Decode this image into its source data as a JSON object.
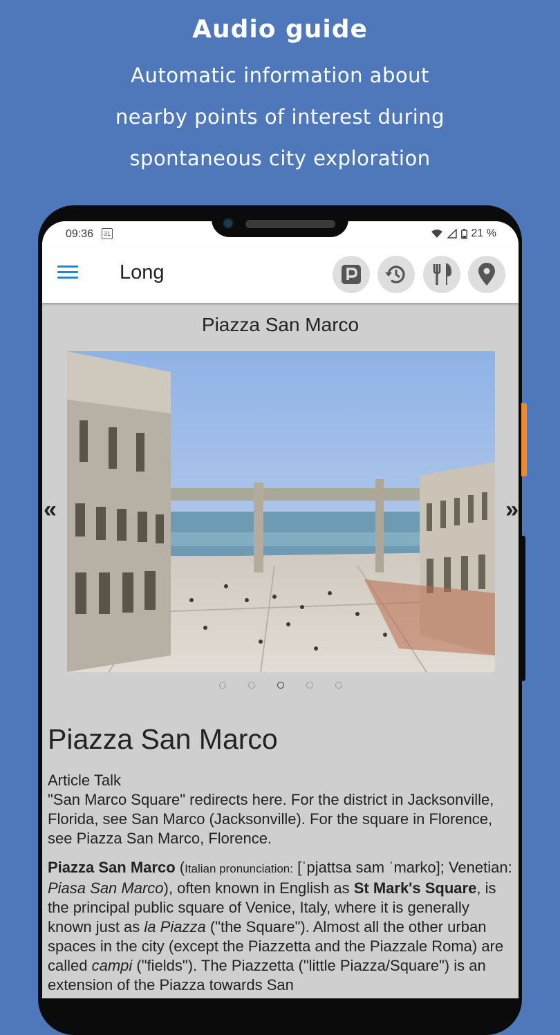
{
  "promo": {
    "title": "Audio guide",
    "line1": "Automatic information about",
    "line2": "nearby points of interest during",
    "line3": "spontaneous city exploration"
  },
  "status_bar": {
    "time": "09:36",
    "calendar_day": "31",
    "battery": "21 %"
  },
  "app_bar": {
    "title": "Long",
    "actions": [
      "parking-icon",
      "history-icon",
      "restaurant-icon",
      "location-pin-icon"
    ]
  },
  "place": {
    "title": "Piazza San Marco",
    "prev_label": "«",
    "next_label": "»",
    "carousel_count": 5,
    "carousel_active_index": 2
  },
  "article": {
    "heading": "Piazza San Marco",
    "tabs_line": "Article Talk",
    "redirect_text": "\"San Marco Square\" redirects here. For the district in Jacksonville, Florida, see San Marco (Jacksonville). For the square in Florence, see Piazza San Marco, Florence.",
    "p_bold_name": "Piazza San Marco",
    "p_pron_label": "Italian pronunciation:",
    "p_pron_value": "[ˈpjattsa sam ˈmarko];",
    "p_venetian": "Venetian:",
    "p_venetian_name": "Piasa San Marco",
    "p_known": "), often known in English as",
    "p_bold_en": "St Mark's Square",
    "p_rest1": ", is the principal public square of Venice, Italy, where it is generally known just as",
    "p_la_piazza": "la Piazza",
    "p_rest2": "(\"the Square\"). Almost all the other urban spaces in the city (except the Piazzetta and the Piazzale Roma) are called",
    "p_campi": "campi",
    "p_rest3": "(\"fields\"). The Piazzetta (\"little Piazza/Square\") is an extension of the Piazza towards San"
  },
  "colors": {
    "background": "#4f78bb",
    "accent": "#1e88d8",
    "side_button": "#f08a28"
  }
}
